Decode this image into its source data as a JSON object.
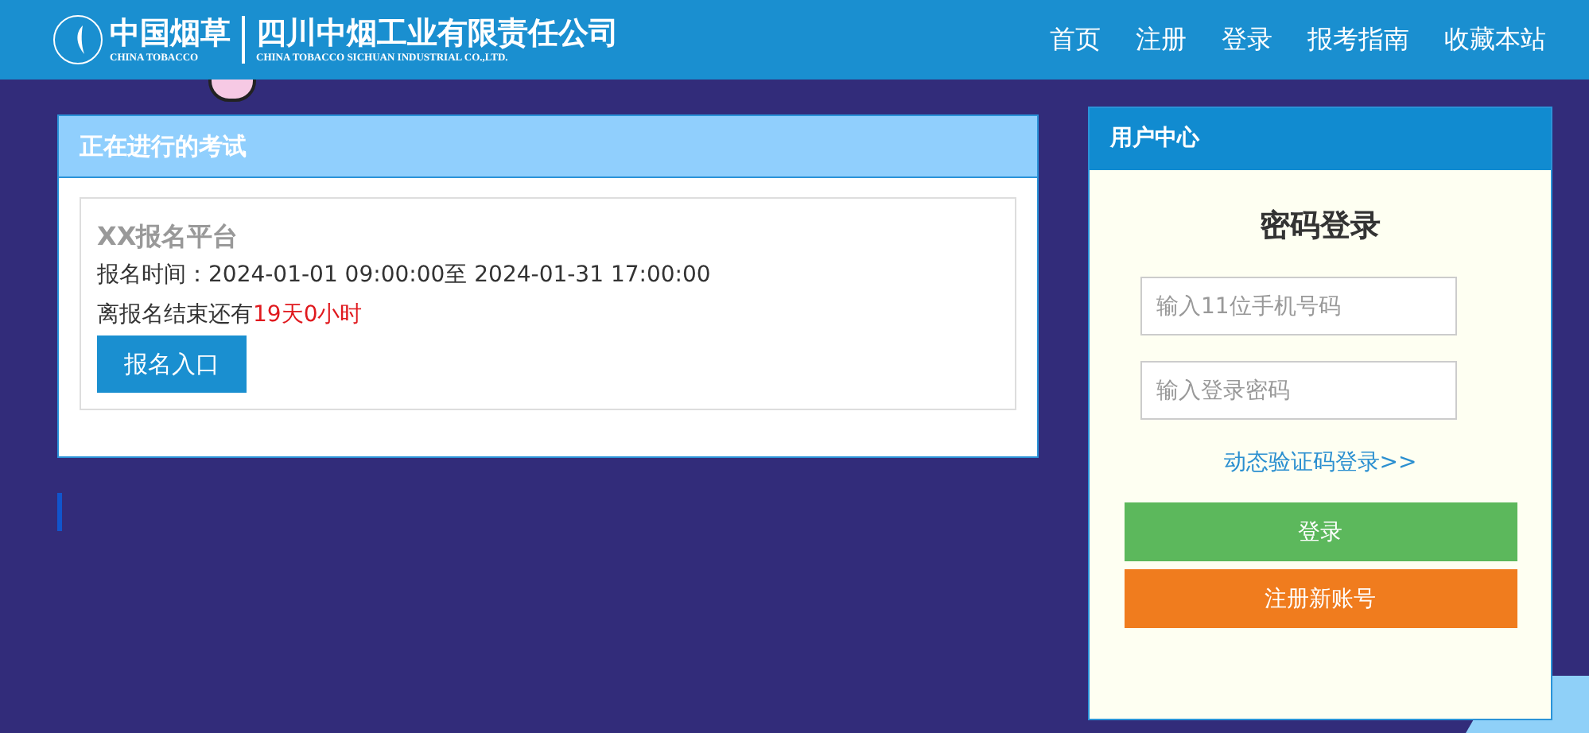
{
  "header": {
    "logo": {
      "brand_cn": "中国烟草",
      "brand_en": "CHINA TOBACCO",
      "company_cn": "四川中烟工业有限责任公司",
      "company_en": "CHINA TOBACCO SICHUAN INDUSTRIAL CO.,LTD."
    },
    "nav": [
      "首页",
      "注册",
      "登录",
      "报考指南",
      "收藏本站"
    ]
  },
  "exams_panel": {
    "title": "正在进行的考试",
    "exams": [
      {
        "name": "XX报名平台",
        "time_text": "报名时间：2024-01-01 09:00:00至 2024-01-31 17:00:00",
        "countdown_prefix": "离报名结束还有",
        "countdown_value": "19天0小时",
        "button": "报名入口"
      }
    ]
  },
  "user_center": {
    "title": "用户中心",
    "heading": "密码登录",
    "phone_field": {
      "placeholder": "输入11位手机号码"
    },
    "password_field": {
      "placeholder": "输入登录密码"
    },
    "sms_link": "动态验证码登录>>",
    "login_button": "登录",
    "register_button": "注册新账号"
  }
}
